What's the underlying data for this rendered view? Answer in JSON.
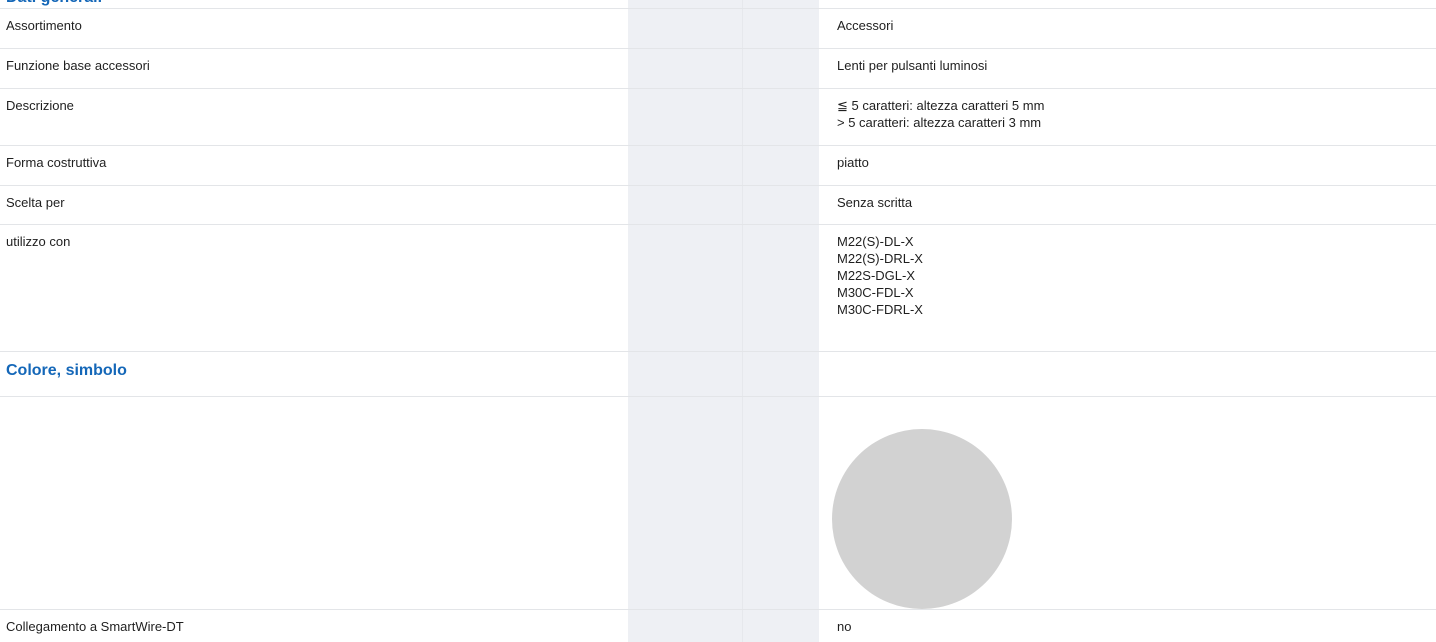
{
  "sections": {
    "top_title": "Dati generali",
    "color_title": "Colore, simbolo"
  },
  "rows": [
    {
      "label": "Assortimento",
      "value": [
        "Accessori"
      ]
    },
    {
      "label": "Funzione base accessori",
      "value": [
        "Lenti per pulsanti luminosi"
      ]
    },
    {
      "label": "Descrizione",
      "value": [
        "≦ 5 caratteri: altezza caratteri 5 mm",
        "> 5 caratteri: altezza caratteri 3 mm"
      ]
    },
    {
      "label": "Forma costruttiva",
      "value": [
        "piatto"
      ]
    },
    {
      "label": "Scelta per",
      "value": [
        "Senza scritta"
      ]
    },
    {
      "label": "utilizzo con",
      "value": [
        "M22(S)-DL-X",
        "M22(S)-DRL-X",
        "M22S-DGL-X",
        "M30C-FDL-X",
        "M30C-FDRL-X"
      ]
    }
  ],
  "color_swatch": {
    "color": "#d2d2d2"
  },
  "last_row": {
    "label": "Collegamento a SmartWire-DT",
    "value": "no"
  }
}
